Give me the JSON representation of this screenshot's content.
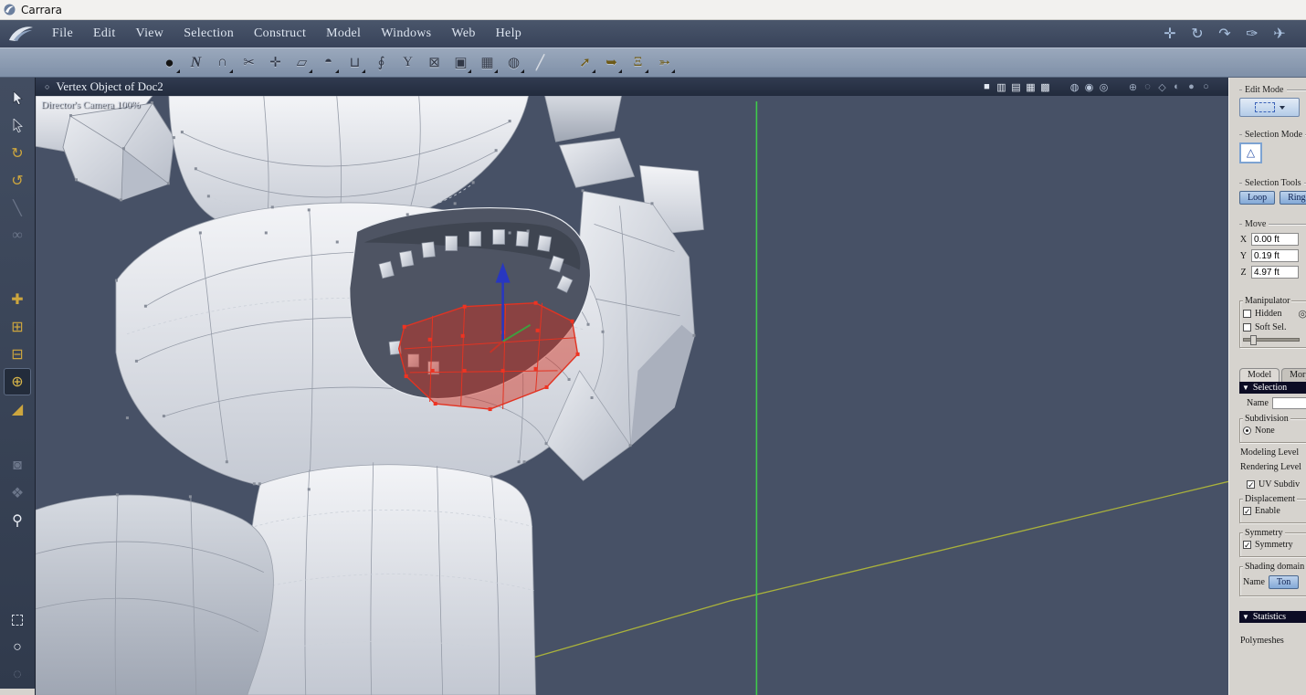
{
  "window": {
    "title": "Carrara"
  },
  "menubar": {
    "items": [
      "File",
      "Edit",
      "View",
      "Selection",
      "Construct",
      "Model",
      "Windows",
      "Web",
      "Help"
    ],
    "right_tools": [
      {
        "name": "pan-hand",
        "glyph": "✛"
      },
      {
        "name": "orbit",
        "glyph": "↻"
      },
      {
        "name": "bank",
        "glyph": "↷"
      },
      {
        "name": "track",
        "glyph": "✑"
      },
      {
        "name": "glide",
        "glyph": "✈"
      }
    ]
  },
  "toolbar": {
    "tools": [
      {
        "name": "sphere",
        "glyph": "●"
      },
      {
        "name": "polyline",
        "glyph": "N"
      },
      {
        "name": "magnet",
        "glyph": "∩"
      },
      {
        "name": "scissors",
        "glyph": "✂"
      },
      {
        "name": "weld",
        "glyph": "✛"
      },
      {
        "name": "polygon",
        "glyph": "▱"
      },
      {
        "name": "dome",
        "glyph": "◓"
      },
      {
        "name": "extrude",
        "glyph": "⊔"
      },
      {
        "name": "twist",
        "glyph": "∮"
      },
      {
        "name": "lathe",
        "glyph": "Y"
      },
      {
        "name": "delete-face",
        "glyph": "⊠"
      },
      {
        "name": "stack",
        "glyph": "▣"
      },
      {
        "name": "wrap",
        "glyph": "▦"
      },
      {
        "name": "smooth",
        "glyph": "◍"
      },
      {
        "name": "edge-line",
        "glyph": "╱"
      },
      {
        "name": "deform",
        "glyph": "➚"
      },
      {
        "name": "flip",
        "glyph": "➥"
      },
      {
        "name": "taper",
        "glyph": "Ξ"
      },
      {
        "name": "sculpt",
        "glyph": "➳"
      }
    ]
  },
  "left_toolbar": {
    "items": [
      {
        "name": "select",
        "glyph": ""
      },
      {
        "name": "direct-select",
        "glyph": ""
      },
      {
        "name": "rotate",
        "glyph": "↻"
      },
      {
        "name": "spin",
        "glyph": "↺"
      },
      {
        "name": "pick",
        "glyph": "╲"
      },
      {
        "name": "link",
        "glyph": "∞"
      },
      {
        "name": "move",
        "glyph": "✚"
      },
      {
        "name": "scale",
        "glyph": "⊞"
      },
      {
        "name": "shear",
        "glyph": "⊟"
      },
      {
        "name": "universal-manipulator",
        "glyph": "⊕"
      },
      {
        "name": "ramp",
        "glyph": "◢"
      },
      {
        "name": "camera",
        "glyph": "◙"
      },
      {
        "name": "pan-hand",
        "glyph": "❖"
      },
      {
        "name": "zoom",
        "glyph": "⚲"
      },
      {
        "name": "lasso",
        "glyph": "○"
      },
      {
        "name": "paint-select",
        "glyph": "◌"
      }
    ]
  },
  "viewport": {
    "title": "Vertex Object of Doc2",
    "circle_glyph": "○",
    "camera_label": "Director's Camera 100%",
    "layout_icons": [
      {
        "name": "single-view",
        "glyph": "■"
      },
      {
        "name": "split-two",
        "glyph": "▥"
      },
      {
        "name": "split-rows",
        "glyph": "▤"
      },
      {
        "name": "split-four",
        "glyph": "▦"
      },
      {
        "name": "split-grid",
        "glyph": "▩"
      }
    ],
    "globe_icons": [
      {
        "name": "globe-wire",
        "glyph": "◍"
      },
      {
        "name": "globe-shaded",
        "glyph": "◉"
      },
      {
        "name": "globe-outline",
        "glyph": "◎"
      }
    ],
    "mode_icons": [
      {
        "name": "target",
        "glyph": "⊕"
      },
      {
        "name": "dashed-circle",
        "glyph": "◌"
      },
      {
        "name": "cube",
        "glyph": "◇"
      },
      {
        "name": "half-sphere",
        "glyph": "◐"
      },
      {
        "name": "sphere-solid",
        "glyph": "●"
      },
      {
        "name": "sphere-light",
        "glyph": "○"
      }
    ]
  },
  "panel": {
    "check_glyph": "✓",
    "collapse_glyph": "▼",
    "edit_mode": {
      "label": "Edit Mode"
    },
    "selection_mode": {
      "label": "Selection Mode",
      "glyph": "△"
    },
    "selection_tools": {
      "label": "Selection Tools",
      "loop": "Loop",
      "ring": "Ring"
    },
    "move": {
      "label": "Move",
      "rows": [
        {
          "axis": "X",
          "value": "0.00 ft"
        },
        {
          "axis": "Y",
          "value": "0.19 ft"
        },
        {
          "axis": "Z",
          "value": "4.97 ft"
        }
      ]
    },
    "manipulator": {
      "label": "Manipulator",
      "hidden": "Hidden",
      "soft_sel": "Soft Sel.",
      "sphere_glyph": "◎"
    },
    "tabs": [
      {
        "label": "Model"
      },
      {
        "label": "Morph"
      }
    ],
    "selection_header": "Selection",
    "selection_name_label": "Name",
    "selection_name_value": "",
    "subdivision": {
      "label": "Subdivision",
      "none": "None",
      "modeling_level": "Modeling Level",
      "rendering_level": "Rendering Level",
      "uv_subdiv": "UV Subdiv"
    },
    "displacement": {
      "label": "Displacement",
      "enable": "Enable"
    },
    "symmetry": {
      "label": "Symmetry",
      "check": "Symmetry"
    },
    "shading": {
      "label": "Shading domain",
      "name_label": "Name",
      "value": "Ton"
    },
    "statistics": {
      "label": "Statistics",
      "polymeshes": "Polymeshes"
    }
  },
  "colors": {
    "selection_red": "#e23322",
    "axis_green": "#3ecb4a",
    "ground_yellow": "#a9b13c",
    "viewport_bg": "#475166",
    "panel_blue": "#84a9d7"
  }
}
